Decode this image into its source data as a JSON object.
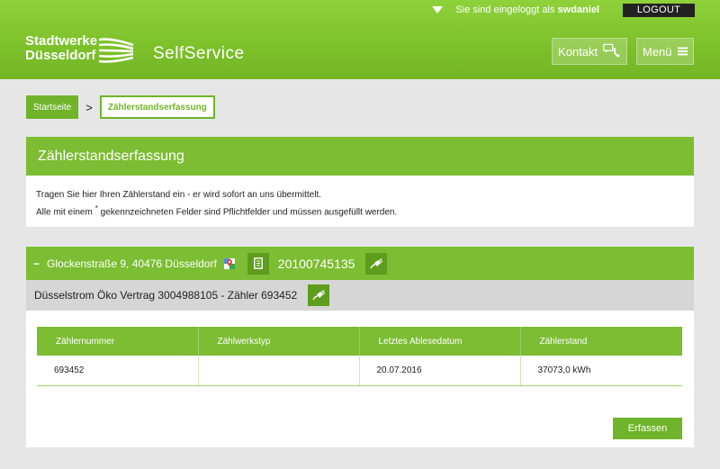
{
  "header": {
    "login_text": "Sie sind eingeloggt als",
    "username": "swdaniel",
    "logout_label": "LOGOUT",
    "logo_line1": "Stadtwerke",
    "logo_line2": "Düsseldorf",
    "product": "SelfService",
    "kontakt_label": "Kontakt",
    "menu_label": "Menü"
  },
  "breadcrumb": {
    "home": "Startseite",
    "separator": ">",
    "current": "Zählerstandserfassung"
  },
  "intro": {
    "title": "Zählerstandserfassung",
    "line1": "Tragen Sie hier Ihren Zählerstand ein - er wird sofort an uns übermittelt.",
    "line2_pre": "Alle mit einem",
    "line2_star": "*",
    "line2_post": "gekennzeichneten Felder sind Pflichtfelder und müssen ausgefüllt werden."
  },
  "location": {
    "collapse": "−",
    "address": "Glockenstraße 9, 40476 Düsseldorf",
    "number": "20100745135",
    "contract": "Düsselstrom Öko Vertrag 3004988105 - Zähler 693452"
  },
  "table": {
    "headers": [
      "Zählernummer",
      "Zählwerkstyp",
      "Letztes Ablesedatum",
      "Zählerstand"
    ],
    "rows": [
      [
        "693452",
        "",
        "20.07.2016",
        "37073,0 kWh"
      ]
    ]
  },
  "actions": {
    "submit_label": "Erfassen"
  },
  "colors": {
    "brand_green": "#7cbd33",
    "dark_green": "#5e9c1d"
  }
}
